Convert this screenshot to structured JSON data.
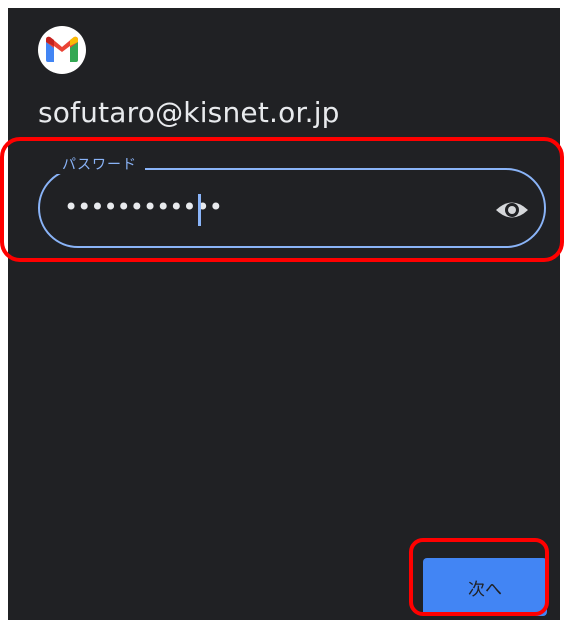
{
  "app": {
    "logo_icon": "gmail-logo-icon",
    "logo_colors": [
      "#ea4335",
      "#4285f4",
      "#34a853",
      "#fbbc04",
      "#c5221f"
    ]
  },
  "account": {
    "email": "sofutaro@kisnet.or.jp"
  },
  "password_field": {
    "label": "パスワード",
    "masked_value": "••••••••••••",
    "visibility_icon": "eye-icon",
    "accent_color": "#8ab4f8"
  },
  "actions": {
    "next_label": "次へ",
    "next_color": "#4285f4"
  },
  "annotations": {
    "highlight_color": "#ff0000"
  }
}
